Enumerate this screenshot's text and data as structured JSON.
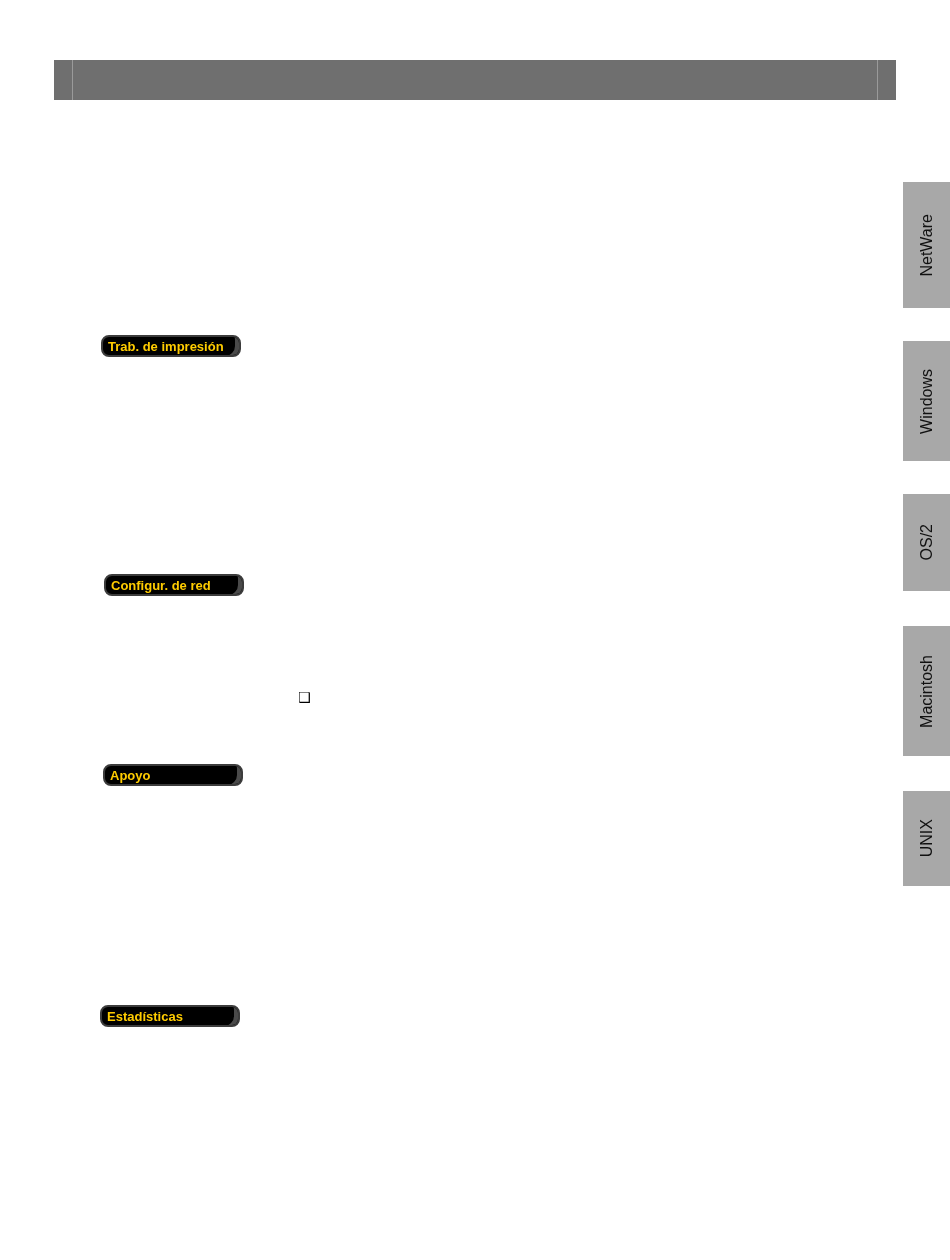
{
  "items": [
    {
      "kind": "section",
      "label": "Trab. de impresión"
    },
    {
      "kind": "section",
      "label": "Configur. de red"
    },
    {
      "kind": "bullet",
      "text": "❑"
    },
    {
      "kind": "section",
      "label": "Apoyo"
    },
    {
      "kind": "section",
      "label": "Estadísticas"
    }
  ],
  "side_tabs": [
    {
      "label": "NetWare"
    },
    {
      "label": "Windows"
    },
    {
      "label": "OS/2"
    },
    {
      "label": "Macintosh"
    },
    {
      "label": "UNIX"
    }
  ]
}
